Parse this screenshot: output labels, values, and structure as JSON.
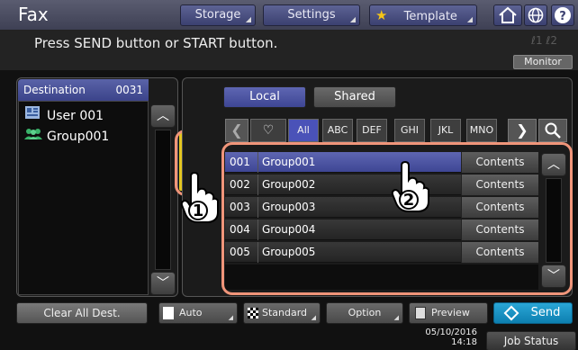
{
  "header": {
    "title": "Fax",
    "buttons": [
      "Storage",
      "Settings",
      "Template"
    ],
    "message": "Press SEND button or START button.",
    "line_indicators": "ℓ1 ℓ2",
    "monitor_label": "Monitor"
  },
  "destination": {
    "header_label": "Destination",
    "count": "0031",
    "items": [
      {
        "icon": "user-icon",
        "label": "User 001"
      },
      {
        "icon": "group-icon",
        "label": "Group001"
      }
    ],
    "clear_label": "Clear All Dest."
  },
  "address_book": {
    "tabs": [
      "Local",
      "Shared"
    ],
    "index_buttons": [
      "All",
      "ABC",
      "DEF",
      "GHI",
      "JKL",
      "MNO"
    ],
    "rows": [
      {
        "num": "001",
        "name": "Group001",
        "action": "Contents"
      },
      {
        "num": "002",
        "name": "Group002",
        "action": "Contents"
      },
      {
        "num": "003",
        "name": "Group003",
        "action": "Contents"
      },
      {
        "num": "004",
        "name": "Group004",
        "action": "Contents"
      },
      {
        "num": "005",
        "name": "Group005",
        "action": "Contents"
      }
    ]
  },
  "callouts": [
    "1",
    "2"
  ],
  "bottom": {
    "buttons": [
      "Auto",
      "Standard",
      "Option",
      "Preview"
    ],
    "send_label": "Send",
    "date": "05/10/2016",
    "time": "14:18",
    "job_status_label": "Job Status"
  },
  "colors": {
    "accent": "#4a52a0",
    "send": "#1b9ed0",
    "highlight": "#f0957a",
    "contact_icon": "#3ab36a"
  }
}
